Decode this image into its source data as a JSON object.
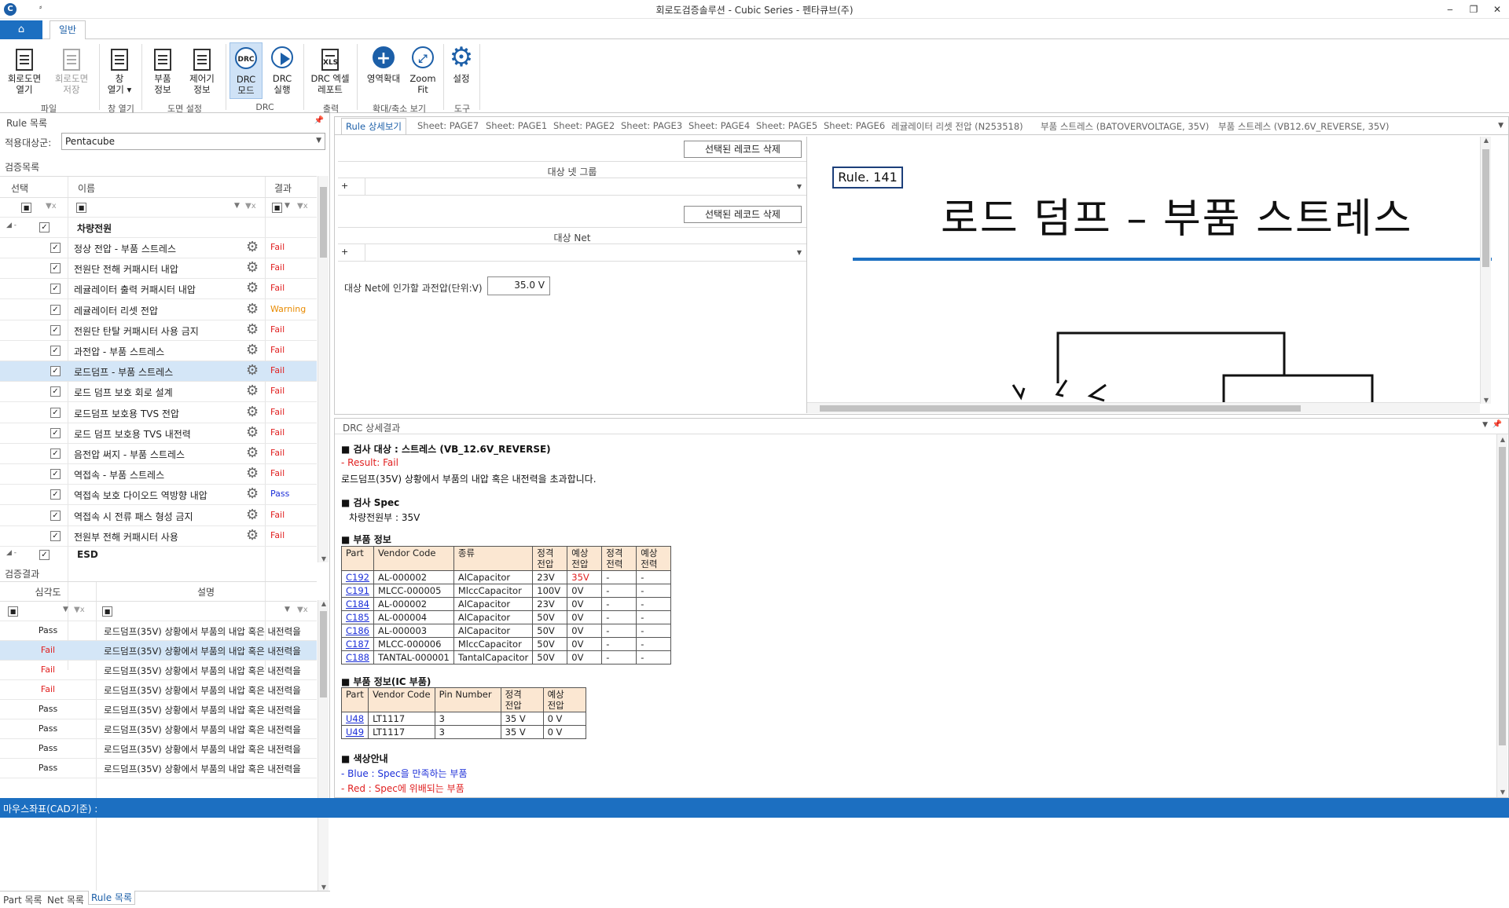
{
  "window": {
    "title": "회로도검증솔루션 - Cubic Series - 펜타큐브(주)",
    "quick_access": "⸗"
  },
  "ribbon_tab": "일반",
  "ribbon": {
    "buttons": [
      {
        "label": "회로도면\n열기",
        "icon": "open-schematic-icon"
      },
      {
        "label": "회로도면\n저장",
        "icon": "save-schematic-icon"
      },
      {
        "label": "창\n열기 ▾",
        "icon": "window-open-icon"
      },
      {
        "label": "부품\n정보",
        "icon": "part-info-icon"
      },
      {
        "label": "제어기\n정보",
        "icon": "controller-info-icon"
      },
      {
        "label": "DRC\n모드",
        "icon": "drc-mode-icon"
      },
      {
        "label": "DRC\n실행",
        "icon": "drc-run-icon"
      },
      {
        "label": "DRC 엑셀\n레포트",
        "icon": "excel-report-icon"
      },
      {
        "label": "영역확대",
        "icon": "zoom-area-icon"
      },
      {
        "label": "Zoom\nFit",
        "icon": "zoom-fit-icon"
      },
      {
        "label": "설정",
        "icon": "settings-icon"
      }
    ],
    "groups": [
      "파일",
      "창 열기",
      "도면 설정",
      "DRC",
      "출력",
      "확대/축소 보기",
      "도구"
    ],
    "drc_badge": "DRC",
    "xls_badge": "XLS"
  },
  "rule_panel": {
    "title": "Rule 목록",
    "target_label": "적용대상군:",
    "target_value": "Pentacube",
    "list_title": "검증목록",
    "columns": [
      "선택",
      "이름",
      "결과"
    ],
    "group1": "차량전원",
    "items": [
      {
        "name": "정상 전압 - 부품 스트레스",
        "result": "Fail"
      },
      {
        "name": "전원단 전해 커패시터 내압",
        "result": "Fail"
      },
      {
        "name": "레귤레이터 출력 커패시터 내압",
        "result": "Fail"
      },
      {
        "name": "레귤레이터 리셋 전압",
        "result": "Warning"
      },
      {
        "name": "전원단 탄탈 커패시터 사용 금지",
        "result": "Fail"
      },
      {
        "name": "과전압 - 부품 스트레스",
        "result": "Fail"
      },
      {
        "name": "로드덤프 - 부품 스트레스",
        "result": "Fail"
      },
      {
        "name": "로드 덤프 보호 회로 설계",
        "result": "Fail"
      },
      {
        "name": "로드덤프 보호용 TVS 전압",
        "result": "Fail"
      },
      {
        "name": "로드 덤프 보호용 TVS 내전력",
        "result": "Fail"
      },
      {
        "name": "음전압 써지 - 부품 스트레스",
        "result": "Fail"
      },
      {
        "name": "역접속 - 부품 스트레스",
        "result": "Fail"
      },
      {
        "name": "역접속 보호 다이오드 역방향 내압",
        "result": "Pass"
      },
      {
        "name": "역접속 시 전류 패스 형성 금지",
        "result": "Fail"
      },
      {
        "name": "전원부 전해 커패시터 사용",
        "result": "Fail"
      }
    ],
    "group2": "ESD"
  },
  "result_panel": {
    "title": "검증결과",
    "columns": [
      "심각도",
      "설명"
    ],
    "rows": [
      {
        "sev": "Pass",
        "desc": "로드덤프(35V) 상황에서 부품의 내압 혹은 내전력을"
      },
      {
        "sev": "Fail",
        "desc": "로드덤프(35V) 상황에서 부품의 내압 혹은 내전력을"
      },
      {
        "sev": "Fail",
        "desc": "로드덤프(35V) 상황에서 부품의 내압 혹은 내전력을"
      },
      {
        "sev": "Fail",
        "desc": "로드덤프(35V) 상황에서 부품의 내압 혹은 내전력을"
      },
      {
        "sev": "Pass",
        "desc": "로드덤프(35V) 상황에서 부품의 내압 혹은 내전력을"
      },
      {
        "sev": "Pass",
        "desc": "로드덤프(35V) 상황에서 부품의 내압 혹은 내전력을"
      },
      {
        "sev": "Pass",
        "desc": "로드덤프(35V) 상황에서 부품의 내압 혹은 내전력을"
      },
      {
        "sev": "Pass",
        "desc": "로드덤프(35V) 상황에서 부품의 내압 혹은 내전력을"
      }
    ]
  },
  "bottom_tabs": [
    "Part 목록",
    "Net 목록",
    "Rule 목록"
  ],
  "doc_tabs": [
    "Rule 상세보기",
    "Sheet: PAGE7",
    "Sheet: PAGE1",
    "Sheet: PAGE2",
    "Sheet: PAGE3",
    "Sheet: PAGE4",
    "Sheet: PAGE5",
    "Sheet: PAGE6",
    "레귤레이터 리셋 전압 (N253518)",
    "부품 스트레스 (BATOVERVOLTAGE, 35V)",
    "부품 스트레스 (VB12.6V_REVERSE, 35V)"
  ],
  "rule_detail": {
    "delete_btn": "선택된 레코드 삭제",
    "net_group": "대상 넷 그룹",
    "net": "대상 Net",
    "volt_label": "대상 Net에 인가할 과전압(단위:V)",
    "volt_value": "35.0 V"
  },
  "canvas": {
    "rule_no": "Rule. 141",
    "title": "로드 덤프 – 부품 스트레스"
  },
  "drc": {
    "title": "DRC 상세결과",
    "target": "■ 검사 대상 : 스트레스 (VB_12.6V_REVERSE)",
    "result": "- Result: Fail",
    "desc": "로드덤프(35V) 상황에서 부품의 내압 혹은 내전력을 초과합니다.",
    "spec_title": "■ 검사 Spec",
    "spec": "차량전원부 : 35V",
    "part_title": "■ 부품 정보",
    "part_headers": [
      "Part",
      "Vendor Code",
      "종류",
      "정격\n전압",
      "예상\n전압",
      "정격\n전력",
      "예상\n전력"
    ],
    "parts": [
      [
        "C192",
        "AL-000002",
        "AlCapacitor",
        "23V",
        "35V",
        "-",
        "-"
      ],
      [
        "C191",
        "MLCC-000005",
        "MlccCapacitor",
        "100V",
        "0V",
        "-",
        "-"
      ],
      [
        "C184",
        "AL-000002",
        "AlCapacitor",
        "23V",
        "0V",
        "-",
        "-"
      ],
      [
        "C185",
        "AL-000004",
        "AlCapacitor",
        "50V",
        "0V",
        "-",
        "-"
      ],
      [
        "C186",
        "AL-000003",
        "AlCapacitor",
        "50V",
        "0V",
        "-",
        "-"
      ],
      [
        "C187",
        "MLCC-000006",
        "MlccCapacitor",
        "50V",
        "0V",
        "-",
        "-"
      ],
      [
        "C188",
        "TANTAL-000001",
        "TantalCapacitor",
        "50V",
        "0V",
        "-",
        "-"
      ]
    ],
    "ic_title": "■ 부품 정보(IC 부품)",
    "ic_headers": [
      "Part",
      "Vendor Code",
      "Pin Number",
      "정격\n전압",
      "예상\n전압"
    ],
    "ics": [
      [
        "U48",
        "LT1117",
        "3",
        "35 V",
        "0 V"
      ],
      [
        "U49",
        "LT1117",
        "3",
        "35 V",
        "0 V"
      ]
    ],
    "color_title": "■ 색상안내",
    "color_blue": "- Blue : Spec을 만족하는 부품",
    "color_red": "- Red : Spec에 위배되는 부품"
  },
  "status": "마우스좌표(CAD기준) :",
  "colors": {
    "accent": "#1c6fc1",
    "fail": "#e02020",
    "warning": "#e88a00",
    "pass": "#1c2fd8",
    "header_fill": "#fbe7d2"
  }
}
